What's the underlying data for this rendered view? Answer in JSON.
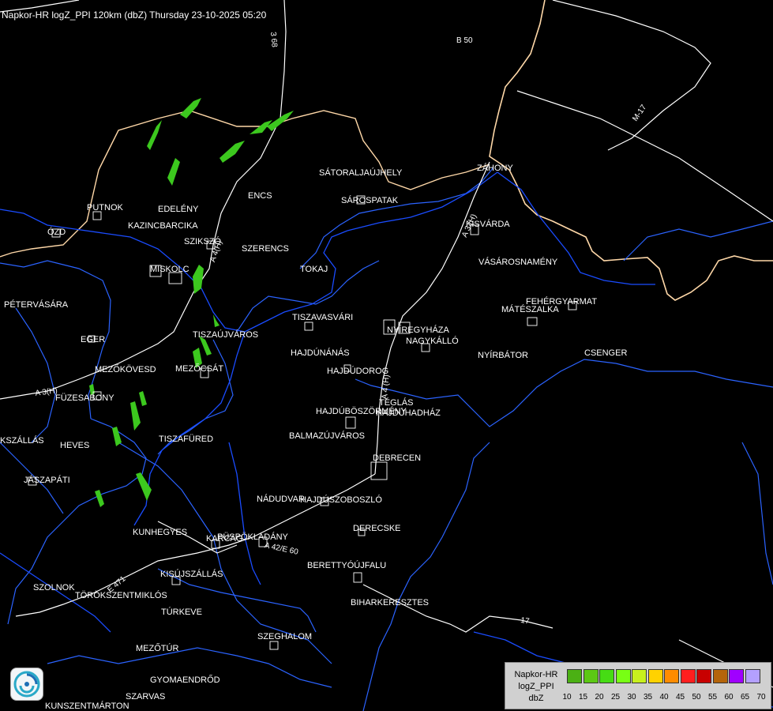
{
  "title": "Napkor-HR logZ_PPI 120km (dbZ) Thursday 23-10-2025 05:20",
  "colors": {
    "background": "#000000",
    "border_country": "#ffd8a8",
    "border_inner": "#2060ff",
    "river": "#1a4cff",
    "road": "#ffffff",
    "echo": "#3cc81e"
  },
  "cities": [
    {
      "name": "PUTNOK"
    },
    {
      "name": "EDELÉNY"
    },
    {
      "name": "KAZINCBARCIKA"
    },
    {
      "name": "ÓZD"
    },
    {
      "name": "SZIKSZÓ"
    },
    {
      "name": "MISKOLC"
    },
    {
      "name": "ENCS"
    },
    {
      "name": "SÁTORALJAÚJHELY"
    },
    {
      "name": "SÁROSPATAK"
    },
    {
      "name": "SZERENCS"
    },
    {
      "name": "TOKAJ"
    },
    {
      "name": "ZÁHONY"
    },
    {
      "name": "KISVÁRDA"
    },
    {
      "name": "VÁSÁROSNAMÉNY"
    },
    {
      "name": "PÉTERVÁSÁRA"
    },
    {
      "name": "EGER"
    },
    {
      "name": "TISZAVASVÁRI"
    },
    {
      "name": "FEHÉRGYARMAT"
    },
    {
      "name": "MÁTÉSZALKA"
    },
    {
      "name": "TISZAÚJVÁROS"
    },
    {
      "name": "NYÍREGYHÁZA"
    },
    {
      "name": "NAGYKÁLLÓ"
    },
    {
      "name": "HAJDÚNÁNÁS"
    },
    {
      "name": "NYÍRBÁTOR"
    },
    {
      "name": "CSENGER"
    },
    {
      "name": "MEZŐKÖVESD"
    },
    {
      "name": "MEZŐCSÁT"
    },
    {
      "name": "HAJDÚDOROG"
    },
    {
      "name": "FÜZESABONY"
    },
    {
      "name": "TÉGLÁS"
    },
    {
      "name": "HAJDÚBÖSZÖRMÉNY"
    },
    {
      "name": "HAJDÚHADHÁZ"
    },
    {
      "name": "BALMAZÚJVÁROS"
    },
    {
      "name": "TISZAFÜRED"
    },
    {
      "name": "KSZÁLLÁS"
    },
    {
      "name": "HEVES"
    },
    {
      "name": "DEBRECEN"
    },
    {
      "name": "JÁSZAPÁTI"
    },
    {
      "name": "NÁDUDVAR"
    },
    {
      "name": "HAJDÚSZOBOSZLÓ"
    },
    {
      "name": "DERECSKE"
    },
    {
      "name": "KUNHEGYES"
    },
    {
      "name": "KARCAG"
    },
    {
      "name": "PÜSPÖKLADÁNY"
    },
    {
      "name": "BERETTYÓÚJFALU"
    },
    {
      "name": "KISÚJSZÁLLÁS"
    },
    {
      "name": "SZOLNOK"
    },
    {
      "name": "TÖRÖKSZENTMIKLÓS"
    },
    {
      "name": "BIHARKERESZTES"
    },
    {
      "name": "TÚRKEVE"
    },
    {
      "name": "SZEGHALOM"
    },
    {
      "name": "MEZŐTÚR"
    },
    {
      "name": "GYOMAENDRŐD"
    },
    {
      "name": "SZARVAS"
    },
    {
      "name": "KUNSZENTMÁRTON"
    }
  ],
  "roads": [
    {
      "name": "3 68"
    },
    {
      "name": "B 50"
    },
    {
      "name": "M-17"
    },
    {
      "name": "A 4(H)"
    },
    {
      "name": "A 3(H)"
    },
    {
      "name": "A 3 (H)"
    },
    {
      "name": "A 4 (H)"
    },
    {
      "name": "A 42/E 60"
    },
    {
      "name": "E 471"
    },
    {
      "name": "17"
    }
  ],
  "legend": {
    "title_line1": "Napkor-HR",
    "title_line2": "logZ_PPI",
    "title_line3": "dbZ",
    "ticks": [
      "10",
      "15",
      "20",
      "25",
      "30",
      "35",
      "40",
      "45",
      "50",
      "55",
      "60",
      "65",
      "70"
    ],
    "colors": [
      "#4bb014",
      "#5cc814",
      "#46dc14",
      "#78ff14",
      "#c8f01e",
      "#ffd200",
      "#ff8c00",
      "#ff1e1e",
      "#c80000",
      "#b4640a",
      "#a000ff",
      "#b4a0ff"
    ]
  }
}
